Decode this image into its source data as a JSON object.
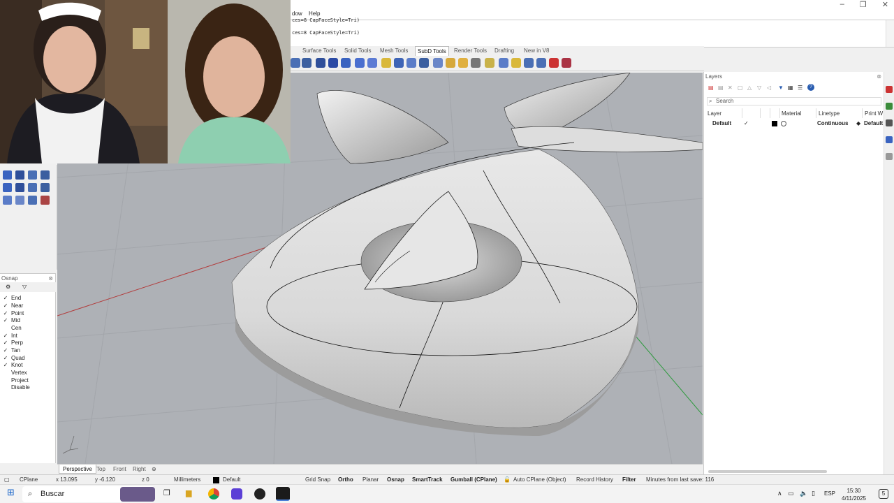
{
  "menu": {
    "window_partial": "dow",
    "help": "Help"
  },
  "command_history": {
    "line1": "ces=8 CapFaceStyle=Tri)",
    "line2": "ces=8 CapFaceStyle=Tri)"
  },
  "toolbar_tabs": [
    "Surface Tools",
    "Solid Tools",
    "Mesh Tools",
    "SubD Tools",
    "Render Tools",
    "Drafting",
    "New in V8"
  ],
  "active_toolbar_tab": "SubD Tools",
  "viewport_tabs": {
    "perspective": "Perspective",
    "top": "Top",
    "front": "Front",
    "right": "Right",
    "add": "⊕"
  },
  "osnap": {
    "title": "Osnap",
    "items": [
      {
        "label": "End",
        "checked": "✓"
      },
      {
        "label": "Near",
        "checked": "✓"
      },
      {
        "label": "Point",
        "checked": "✓"
      },
      {
        "label": "Mid",
        "checked": "✓"
      },
      {
        "label": "Cen",
        "checked": ""
      },
      {
        "label": "Int",
        "checked": "✓"
      },
      {
        "label": "Perp",
        "checked": "✓"
      },
      {
        "label": "Tan",
        "checked": "✓"
      },
      {
        "label": "Quad",
        "checked": "✓"
      },
      {
        "label": "Knot",
        "checked": "✓"
      },
      {
        "label": "Vertex",
        "checked": ""
      },
      {
        "label": "Project",
        "checked": ""
      },
      {
        "label": "Disable",
        "checked": ""
      }
    ]
  },
  "layers": {
    "title": "Layers",
    "search_placeholder": "Search",
    "columns": {
      "layer": "Layer",
      "material": "Material",
      "linetype": "Linetype",
      "print_width": "Print W"
    },
    "rows": [
      {
        "name": "Default",
        "current": "✓",
        "linetype": "Continuous",
        "print_width": "Default"
      }
    ]
  },
  "statusbar": {
    "cplane": "CPlane",
    "x": "x 13.095",
    "y": "y -6.120",
    "z": "z 0",
    "units": "Millimeters",
    "layer": "Default",
    "grid_snap": "Grid Snap",
    "ortho": "Ortho",
    "planar": "Planar",
    "osnap": "Osnap",
    "smarttrack": "SmartTrack",
    "gumball": "Gumball (CPlane)",
    "auto_cplane": "Auto CPlane (Object)",
    "record_history": "Record History",
    "filter": "Filter",
    "last_save": "Minutes from last save: 116"
  },
  "taskbar": {
    "search": "Buscar",
    "language": "ESP",
    "time": "15:30",
    "date": "4/11/2025",
    "notifications": "5"
  },
  "colors": {
    "viewport_bg": "#aeb1b6",
    "x_axis": "#b23a3a",
    "y_axis": "#2e9a3e"
  }
}
